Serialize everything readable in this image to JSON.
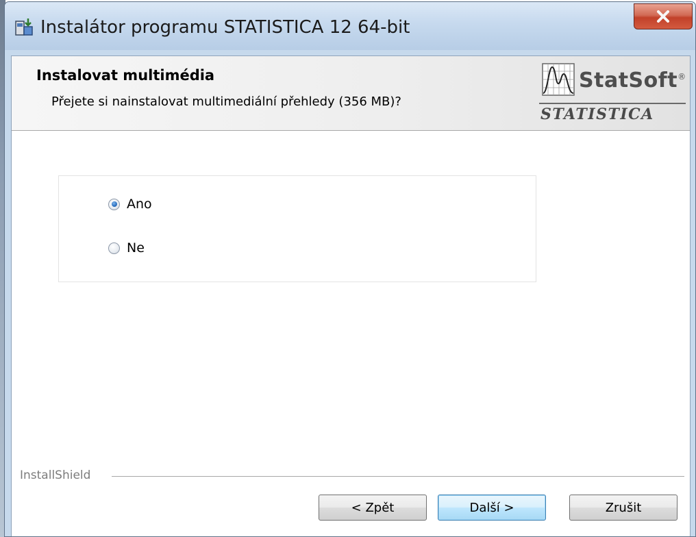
{
  "window": {
    "title": "Instalátor programu STATISTICA 12 64-bit",
    "icon": "installer-icon",
    "close_icon": "close-icon"
  },
  "header": {
    "title": "Instalovat multimédia",
    "subtitle": "Přejete si nainstalovat multimediální přehledy (356 MB)?",
    "logo": {
      "brand": "StatSoft",
      "registered_mark": "®",
      "product": "STATISTICA",
      "icon": "statsoft-logo-icon"
    }
  },
  "options": [
    {
      "label": "Ano",
      "selected": true
    },
    {
      "label": "Ne",
      "selected": false
    }
  ],
  "footer": {
    "installshield": "InstallShield",
    "buttons": {
      "back": "< Zpět",
      "next": "Další >",
      "cancel": "Zrušit"
    }
  },
  "colors": {
    "close_button": "#c2412a",
    "default_button": "#bee6fd",
    "radio_selected": "#2a6fc0"
  }
}
